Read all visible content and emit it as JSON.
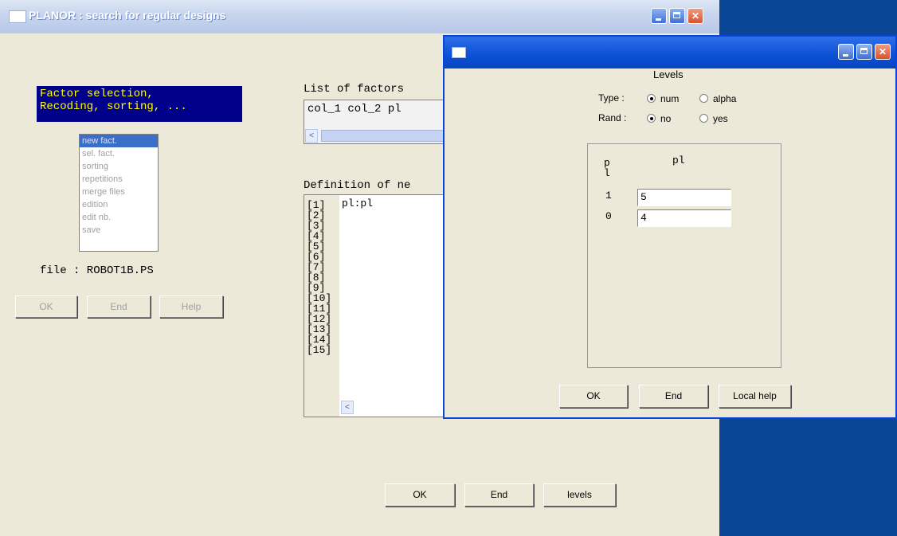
{
  "main_window": {
    "title": "PLANOR : search for regular designs",
    "factor_panel": {
      "line1": "Factor selection,",
      "line2": "Recoding, sorting, ..."
    },
    "menu_items": [
      "new fact.",
      "sel. fact.",
      "sorting",
      "repetitions",
      "merge files",
      "edition",
      "edit nb.",
      "save"
    ],
    "selected_menu_index": 0,
    "file_label": "file : ROBOT1B.PS",
    "left_buttons": {
      "ok": "OK",
      "end": "End",
      "help": "Help"
    },
    "factors_list_label": "List of factors",
    "factors_list_value": "col_1 col_2 pl",
    "definition_label": "Definition of ne",
    "definition_line_numbers": [
      "[1]",
      "[2]",
      "[3]",
      "[4]",
      "[5]",
      "[6]",
      "[7]",
      "[8]",
      "[9]",
      "[10]",
      "[11]",
      "[12]",
      "[13]",
      "[14]",
      "[15]"
    ],
    "definition_first_entry": "pl:pl",
    "bottom_buttons": {
      "ok": "OK",
      "end": "End",
      "levels": "levels"
    }
  },
  "levels_dialog": {
    "title": "",
    "heading": "Levels",
    "type_label": "Type :",
    "type_options": [
      "num",
      "alpha"
    ],
    "type_selected": "num",
    "rand_label": "Rand :",
    "rand_options": [
      "no",
      "yes"
    ],
    "rand_selected": "no",
    "column_header_left_1": "p",
    "column_header_left_2": "l",
    "column_header_right": "pl",
    "rows": [
      {
        "label": "1",
        "value": "5"
      },
      {
        "label": "0",
        "value": "4"
      }
    ],
    "buttons": {
      "ok": "OK",
      "end": "End",
      "help": "Local help"
    }
  },
  "colors": {
    "desktop_blue": "#0a4696",
    "dialog_title_blue": "#0b50d6",
    "factor_panel_bg": "#00008b",
    "factor_panel_text": "#ffff00",
    "selection_blue": "#3a6ec8"
  }
}
